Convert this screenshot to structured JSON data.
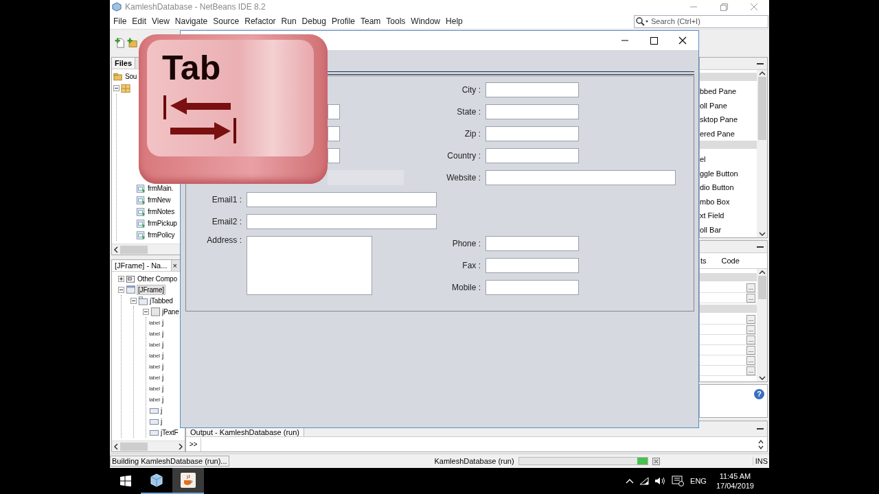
{
  "ide": {
    "title": "KamleshDatabase - NetBeans IDE 8.2",
    "menu": [
      "File",
      "Edit",
      "View",
      "Navigate",
      "Source",
      "Refactor",
      "Run",
      "Debug",
      "Profile",
      "Team",
      "Tools",
      "Window",
      "Help"
    ],
    "search": {
      "placeholder": "Search (Ctrl+I)"
    },
    "files": {
      "title": "Files",
      "tree": [
        {
          "label": "Sou",
          "kind": "folder"
        },
        {
          "kind": "package",
          "expanded": true,
          "children": [
            {
              "label": "frmMain.",
              "kind": "form"
            },
            {
              "label": "frmNew",
              "kind": "form"
            },
            {
              "label": "frmNotes",
              "kind": "form"
            },
            {
              "label": "frmPickup",
              "kind": "form"
            },
            {
              "label": "frmPolicy",
              "kind": "form"
            }
          ]
        }
      ]
    },
    "navigator": {
      "title": "[JFrame] - Na...",
      "close": "×",
      "tree": [
        {
          "label": "Other Compo",
          "kind": "other",
          "expanded": false,
          "selected": false
        },
        {
          "label": "[JFrame]",
          "kind": "frame",
          "expanded": true,
          "selected": true,
          "children": [
            {
              "label": "jTabbed",
              "kind": "tabbed",
              "expanded": true,
              "selected": false,
              "children": [
                {
                  "label": "jPane",
                  "kind": "panel",
                  "expanded": true,
                  "selected": false,
                  "children": [
                    {
                      "label": "j",
                      "kind": "label",
                      "badge": "label",
                      "selected": false
                    },
                    {
                      "label": "j",
                      "kind": "label",
                      "badge": "label",
                      "selected": false
                    },
                    {
                      "label": "j",
                      "kind": "label",
                      "badge": "label",
                      "selected": false
                    },
                    {
                      "label": "j",
                      "kind": "label",
                      "badge": "label",
                      "selected": false
                    },
                    {
                      "label": "j",
                      "kind": "label",
                      "badge": "label",
                      "selected": false
                    },
                    {
                      "label": "j",
                      "kind": "label",
                      "badge": "label",
                      "selected": false
                    },
                    {
                      "label": "j",
                      "kind": "label",
                      "badge": "label",
                      "selected": false
                    },
                    {
                      "label": "j",
                      "kind": "label",
                      "badge": "label",
                      "selected": false
                    },
                    {
                      "label": "j",
                      "kind": "field",
                      "selected": false
                    },
                    {
                      "label": "j",
                      "kind": "field",
                      "selected": false
                    },
                    {
                      "label": "jTextF",
                      "kind": "field",
                      "selected": false
                    }
                  ]
                }
              ]
            }
          ]
        }
      ]
    },
    "palette": {
      "items": [
        {
          "kind": "category"
        },
        {
          "kind": "item",
          "label": "bbed Pane"
        },
        {
          "kind": "item",
          "label": "oll Pane"
        },
        {
          "kind": "item",
          "label": "sktop Pane"
        },
        {
          "kind": "item",
          "label": "ered Pane"
        },
        {
          "kind": "category"
        },
        {
          "kind": "item",
          "label": "el"
        },
        {
          "kind": "item",
          "label": "ggle Button"
        },
        {
          "kind": "item",
          "label": "dio Button"
        },
        {
          "kind": "item",
          "label": "mbo Box"
        },
        {
          "kind": "item",
          "label": "xt Field"
        },
        {
          "kind": "item",
          "label": "oll Bar"
        }
      ]
    },
    "properties": {
      "tabs": [
        "ts",
        "Code"
      ],
      "rows": [
        {
          "kind": "category"
        },
        {
          "kind": "property",
          "button": "..."
        },
        {
          "kind": "property",
          "button": "..."
        },
        {
          "kind": "category"
        },
        {
          "kind": "property",
          "button": "..."
        },
        {
          "kind": "property",
          "button": "..."
        },
        {
          "kind": "property",
          "button": "..."
        },
        {
          "kind": "property",
          "button": "..."
        },
        {
          "kind": "property",
          "button": "..."
        },
        {
          "kind": "property",
          "button": "..."
        }
      ]
    },
    "help": "?",
    "output": {
      "tab": "Output - KamleshDatabase (run)",
      "button": ">>"
    },
    "status_bar": {
      "message": "Building KamleshDatabase (run)...",
      "task": "KamleshDatabase (run)",
      "level": 0.08,
      "mode": "INS"
    }
  },
  "form_window": {
    "left": [
      {
        "kind": "edge",
        "disabled": false
      },
      {
        "kind": "edge",
        "disabled": false
      },
      {
        "kind": "edge",
        "disabled": false
      },
      {
        "kind": "edge_wide",
        "disabled": true
      },
      {
        "kind": "long",
        "label": "Email1 :",
        "disabled": false
      },
      {
        "kind": "long",
        "label": "Email2 :",
        "disabled": false
      },
      {
        "kind": "area",
        "label": "Address :",
        "disabled": false
      }
    ],
    "right_top": [
      {
        "label": "City :",
        "kind": "short"
      },
      {
        "label": "State :",
        "kind": "short"
      },
      {
        "label": "Zip :",
        "kind": "short"
      },
      {
        "label": "Country :",
        "kind": "short"
      },
      {
        "label": "Website :",
        "kind": "long"
      }
    ],
    "right_bottom": [
      {
        "label": "Phone :",
        "kind": "short"
      },
      {
        "label": "Fax :",
        "kind": "short"
      },
      {
        "label": "Mobile :",
        "kind": "short"
      }
    ]
  },
  "tab_key": {
    "label": "Tab"
  },
  "taskbar": {
    "apps": [
      {
        "kind": "cube",
        "selected": false
      },
      {
        "kind": "java",
        "selected": true
      }
    ],
    "language": "ENG",
    "time": "11:45 AM",
    "date": "17/04/2019"
  }
}
